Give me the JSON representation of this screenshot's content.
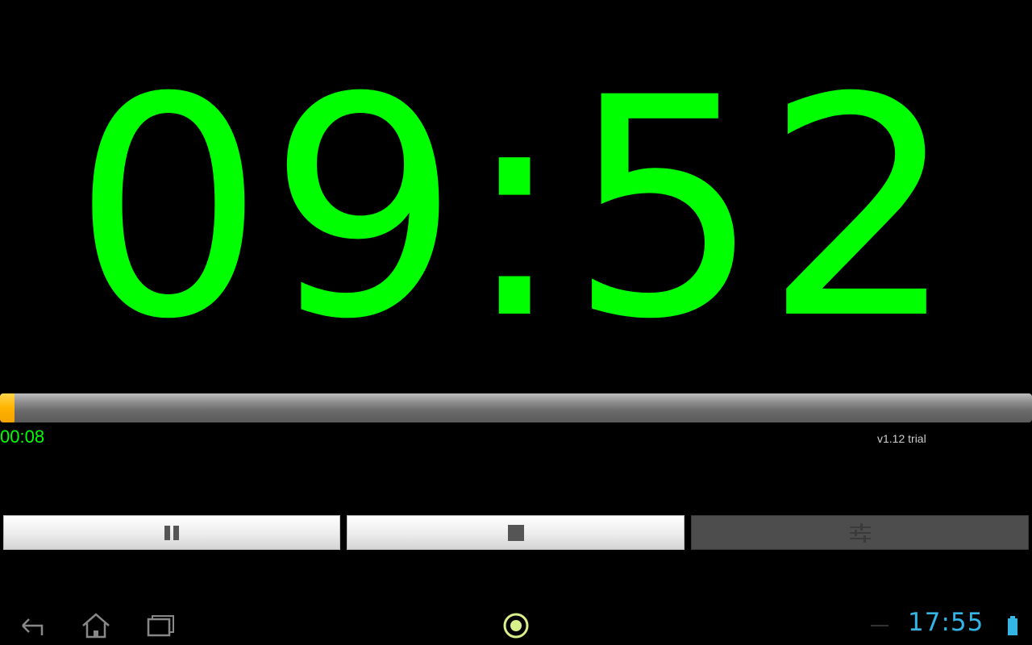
{
  "timer": {
    "display": "09:52",
    "elapsed": "00:08",
    "progress_fraction": 0.014
  },
  "version_label": "v1.12 trial",
  "buttons": [
    {
      "name": "pause",
      "icon": "pause-icon"
    },
    {
      "name": "stop",
      "icon": "stop-icon"
    },
    {
      "name": "settings",
      "icon": "sliders-icon"
    }
  ],
  "system_bar": {
    "clock": "17:55",
    "nav_icons": [
      "back-icon",
      "home-icon",
      "recent-apps-icon"
    ],
    "center_icon": "app-indicator-icon",
    "status_icons": [
      "notification-dash-icon",
      "battery-icon"
    ]
  },
  "colors": {
    "timer_text": "#00ff00",
    "progress_fill": "#ffb300",
    "clock_text": "#33b5e5"
  }
}
